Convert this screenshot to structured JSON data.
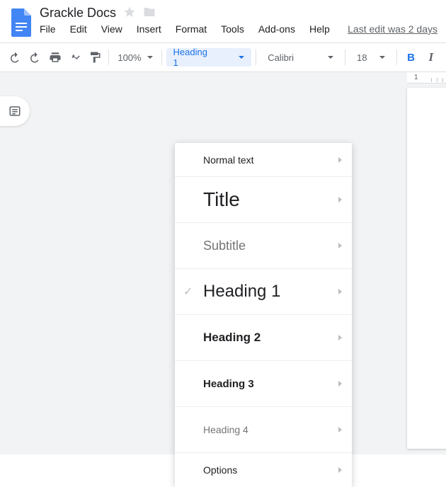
{
  "header": {
    "title": "Grackle Docs",
    "last_edit": "Last edit was 2 days"
  },
  "menu": {
    "file": "File",
    "edit": "Edit",
    "view": "View",
    "insert": "Insert",
    "format": "Format",
    "tools": "Tools",
    "addons": "Add-ons",
    "help": "Help"
  },
  "toolbar": {
    "zoom": "100%",
    "style": "Heading 1",
    "font": "Calibri",
    "size": "18",
    "bold": "B",
    "italic": "I"
  },
  "ruler": {
    "one": "1"
  },
  "styles_dropdown": {
    "items": [
      {
        "label": "Normal text",
        "cls": "s-normal",
        "short": true,
        "checked": false
      },
      {
        "label": "Title",
        "cls": "s-title",
        "short": false,
        "checked": false
      },
      {
        "label": "Subtitle",
        "cls": "s-subtitle",
        "short": false,
        "checked": false
      },
      {
        "label": "Heading 1",
        "cls": "s-h1",
        "short": false,
        "checked": true
      },
      {
        "label": "Heading 2",
        "cls": "s-h2",
        "short": false,
        "checked": false
      },
      {
        "label": "Heading 3",
        "cls": "s-h3",
        "short": false,
        "checked": false
      },
      {
        "label": "Heading 4",
        "cls": "s-h4",
        "short": false,
        "checked": false
      },
      {
        "label": "Options",
        "cls": "s-opt",
        "short": true,
        "checked": false
      }
    ]
  }
}
